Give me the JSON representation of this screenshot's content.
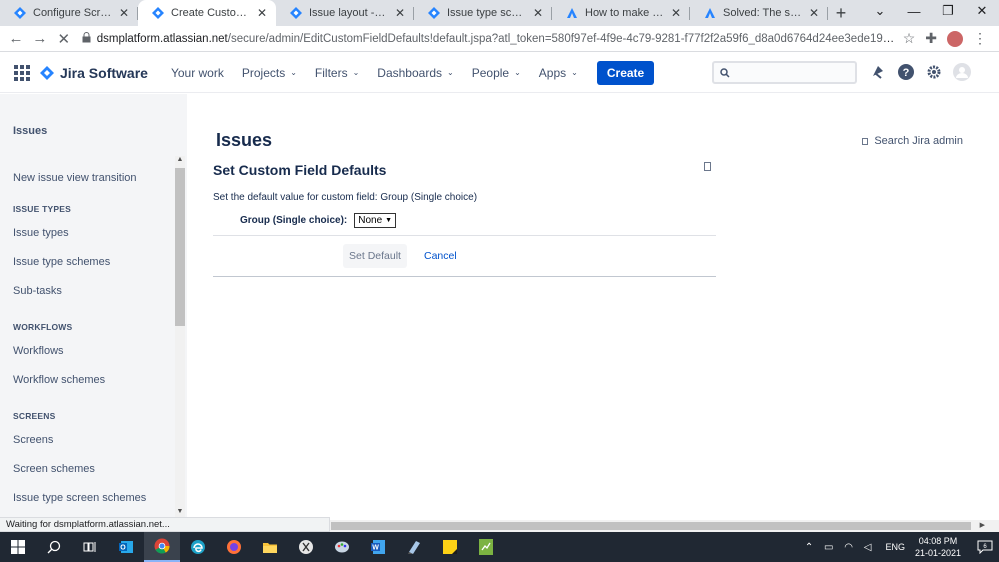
{
  "browser": {
    "tabs": [
      {
        "title": "Configure Screen - JIRA",
        "icon": "jira-diamond-icon",
        "active": false
      },
      {
        "title": "Create Custom Field - D",
        "icon": "jira-diamond-icon",
        "active": true
      },
      {
        "title": "Issue layout - JIRA",
        "icon": "jira-diamond-icon",
        "active": false
      },
      {
        "title": "Issue type schemes - JI",
        "icon": "jira-diamond-icon",
        "active": false
      },
      {
        "title": "How to make Epic Link",
        "icon": "atlassian-a-icon",
        "active": false
      },
      {
        "title": "Solved: The script runn",
        "icon": "atlassian-a-icon",
        "active": false
      }
    ],
    "new_tab_label": "+",
    "url_host": "dsmplatform.atlassian.net",
    "url_path": "/secure/admin/EditCustomFieldDefaults!default.jspa?atl_token=580f97ef-4f9e-4c79-9281-f77f2f2a59f6_d8a0d6764d24ee3ede19eb8cbdfdfb5e53f8...",
    "status_text": "Waiting for dsmplatform.atlassian.net..."
  },
  "jira_nav": {
    "product": "Jira Software",
    "items": [
      {
        "label": "Your work",
        "dropdown": false
      },
      {
        "label": "Projects",
        "dropdown": true
      },
      {
        "label": "Filters",
        "dropdown": true
      },
      {
        "label": "Dashboards",
        "dropdown": true
      },
      {
        "label": "People",
        "dropdown": true
      },
      {
        "label": "Apps",
        "dropdown": true
      }
    ],
    "create_label": "Create",
    "search_placeholder": ""
  },
  "sidebar": {
    "title": "Issues",
    "entries": [
      {
        "type": "item",
        "label": "New issue view transition"
      },
      {
        "type": "heading",
        "label": "ISSUE TYPES"
      },
      {
        "type": "item",
        "label": "Issue types"
      },
      {
        "type": "item",
        "label": "Issue type schemes"
      },
      {
        "type": "item",
        "label": "Sub-tasks"
      },
      {
        "type": "heading",
        "label": "WORKFLOWS"
      },
      {
        "type": "item",
        "label": "Workflows"
      },
      {
        "type": "item",
        "label": "Workflow schemes"
      },
      {
        "type": "heading",
        "label": "SCREENS"
      },
      {
        "type": "item",
        "label": "Screens"
      },
      {
        "type": "item",
        "label": "Screen schemes"
      },
      {
        "type": "item",
        "label": "Issue type screen schemes"
      }
    ]
  },
  "main": {
    "page_title": "Issues",
    "admin_search_label": "Search Jira admin",
    "section_title": "Set Custom Field Defaults",
    "description": "Set the default value for custom field: Group (Single choice)",
    "field_label": "Group (Single choice):",
    "field_value": "None",
    "set_default_label": "Set Default",
    "cancel_label": "Cancel"
  },
  "taskbar": {
    "language": "ENG",
    "time": "04:08 PM",
    "date": "21-01-2021",
    "notification_count": "6"
  },
  "colors": {
    "jira_blue": "#0052cc",
    "sidebar_bg": "#f4f5f7",
    "tabstrip_bg": "#dee1e6",
    "taskbar_bg": "#202833"
  }
}
